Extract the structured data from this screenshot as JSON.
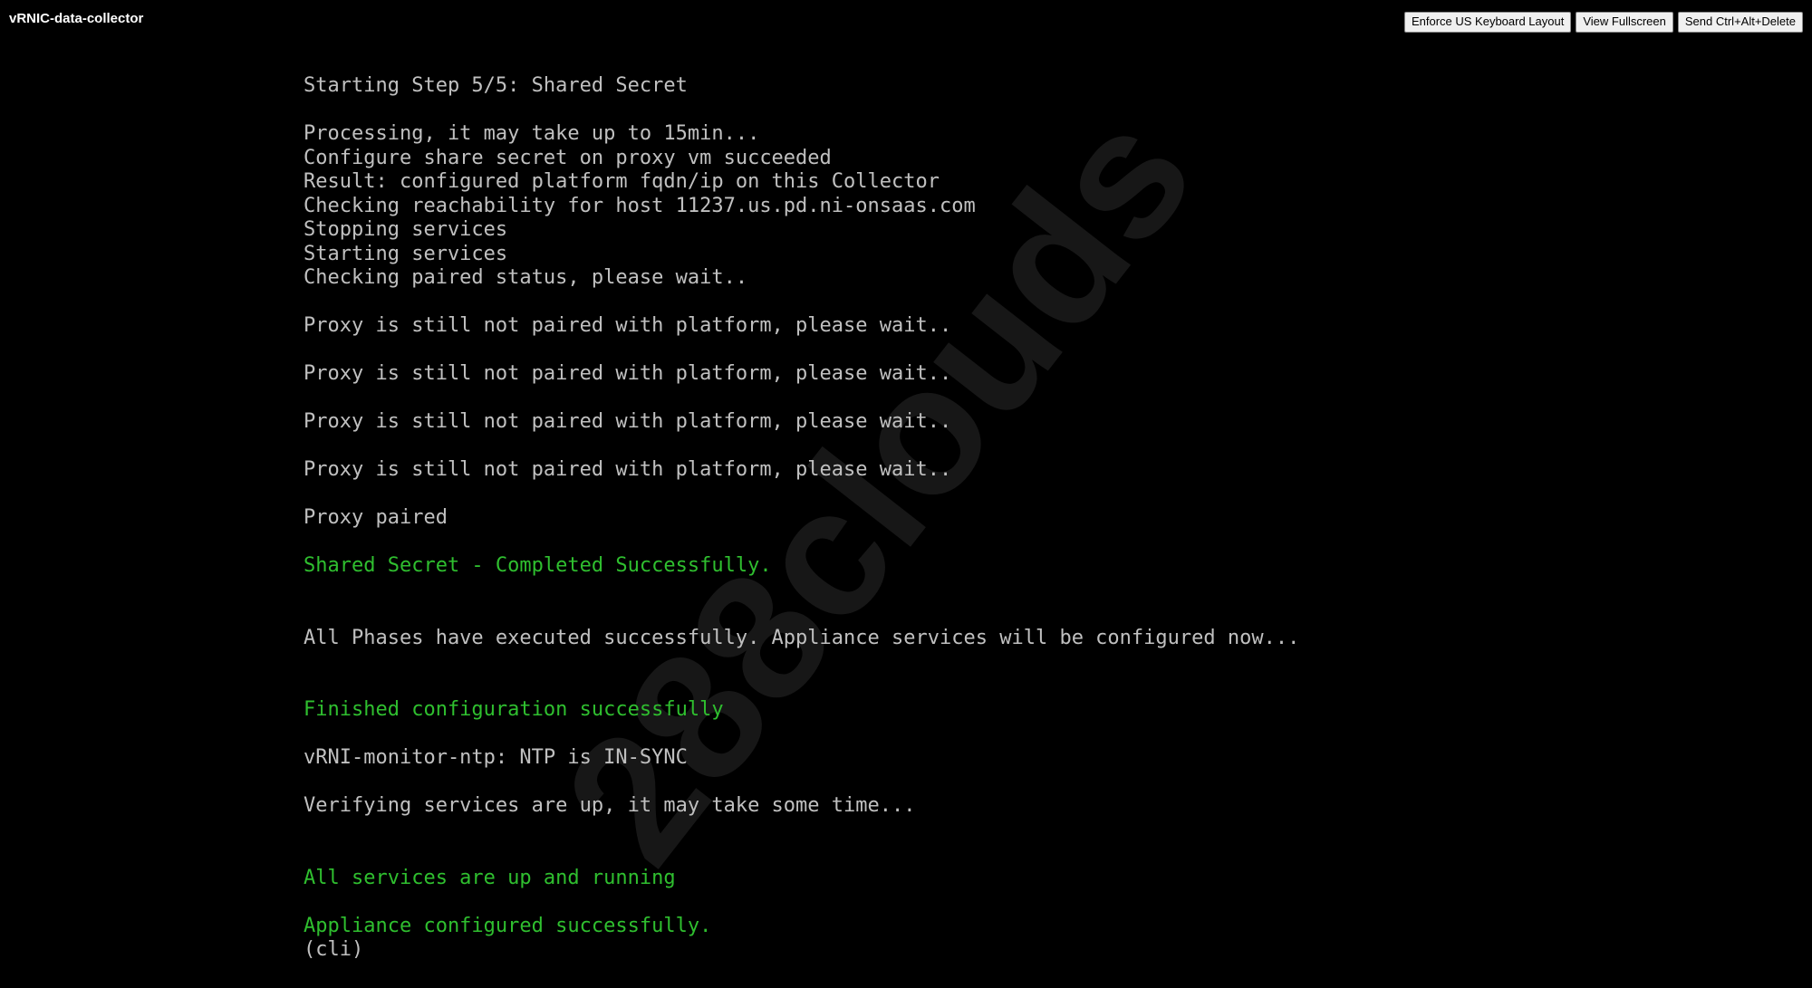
{
  "window": {
    "title": "vRNIC-data-collector"
  },
  "toolbar": {
    "enforce_keyboard_label": "Enforce US Keyboard Layout",
    "fullscreen_label": "View Fullscreen",
    "ctrl_alt_del_label": "Send Ctrl+Alt+Delete"
  },
  "watermark": {
    "text": "288clouds"
  },
  "colors": {
    "background": "#000000",
    "console_text": "#c0c0c0",
    "success_text": "#2fbf2f"
  },
  "console": {
    "lines": [
      {
        "text": "Starting Step 5/5: Shared Secret",
        "color": "default"
      },
      {
        "text": "",
        "color": "default"
      },
      {
        "text": "Processing, it may take up to 15min...",
        "color": "default"
      },
      {
        "text": "Configure share secret on proxy vm succeeded",
        "color": "default"
      },
      {
        "text": "Result: configured platform fqdn/ip on this Collector",
        "color": "default"
      },
      {
        "text": "Checking reachability for host 11237.us.pd.ni-onsaas.com",
        "color": "default"
      },
      {
        "text": "Stopping services",
        "color": "default"
      },
      {
        "text": "Starting services",
        "color": "default"
      },
      {
        "text": "Checking paired status, please wait..",
        "color": "default"
      },
      {
        "text": "",
        "color": "default"
      },
      {
        "text": "Proxy is still not paired with platform, please wait..",
        "color": "default"
      },
      {
        "text": "",
        "color": "default"
      },
      {
        "text": "Proxy is still not paired with platform, please wait..",
        "color": "default"
      },
      {
        "text": "",
        "color": "default"
      },
      {
        "text": "Proxy is still not paired with platform, please wait..",
        "color": "default"
      },
      {
        "text": "",
        "color": "default"
      },
      {
        "text": "Proxy is still not paired with platform, please wait..",
        "color": "default"
      },
      {
        "text": "",
        "color": "default"
      },
      {
        "text": "Proxy paired",
        "color": "default"
      },
      {
        "text": "",
        "color": "default"
      },
      {
        "text": "Shared Secret - Completed Successfully.",
        "color": "green"
      },
      {
        "text": "",
        "color": "default"
      },
      {
        "text": "",
        "color": "default"
      },
      {
        "text": "All Phases have executed successfully. Appliance services will be configured now...",
        "color": "default"
      },
      {
        "text": "",
        "color": "default"
      },
      {
        "text": "",
        "color": "default"
      },
      {
        "text": "Finished configuration successfully",
        "color": "green"
      },
      {
        "text": "",
        "color": "default"
      },
      {
        "text": "vRNI-monitor-ntp: NTP is IN-SYNC",
        "color": "default"
      },
      {
        "text": "",
        "color": "default"
      },
      {
        "text": "Verifying services are up, it may take some time...",
        "color": "default"
      },
      {
        "text": "",
        "color": "default"
      },
      {
        "text": "",
        "color": "default"
      },
      {
        "text": "All services are up and running",
        "color": "green"
      },
      {
        "text": "",
        "color": "default"
      },
      {
        "text": "Appliance configured successfully.",
        "color": "green"
      },
      {
        "text": "(cli)",
        "color": "default"
      }
    ]
  }
}
